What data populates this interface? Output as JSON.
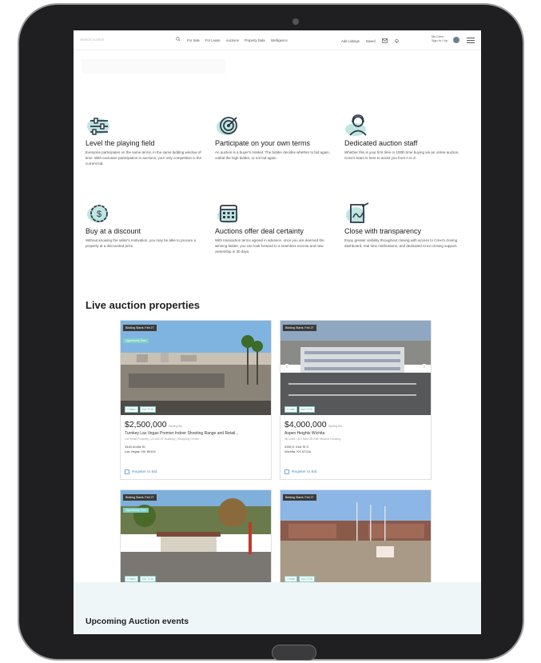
{
  "nav": {
    "search_placeholder": "Search Auction",
    "links": [
      "For Sale",
      "For Lease",
      "Auctions",
      "Property Data",
      "Intelligence"
    ],
    "add_listings": "Add Listings",
    "saved": "Saved",
    "signin_line1": "My Crexi",
    "signin_line2": "Sign In / Up"
  },
  "features": [
    {
      "title": "Level the playing field",
      "text": "Everyone participates on the same terms, in the same bidding window of time. With exclusive participation in auctions, your only competition is the current bid.",
      "icon": "sliders-icon"
    },
    {
      "title": "Participate on your own terms",
      "text": "An auction is a buyer's market. The bidder decides whether to bid again, outbid the high bidder, or not bid again.",
      "icon": "target-icon"
    },
    {
      "title": "Dedicated auction staff",
      "text": "Whether this is your first time or 100th time buying via an online auction, Crexi's team is here to assist you from A to Z.",
      "icon": "support-agent-icon"
    },
    {
      "title": "Buy at a discount",
      "text": "Without knowing the seller's motivation, you may be able to procure a property at a discounted price.",
      "icon": "dollar-circle-icon"
    },
    {
      "title": "Auctions offer deal certainty",
      "text": "With transaction terms agreed in advance, once you are deemed the winning bidder, you can look forward to a seamless escrow and new ownership in 30 days.",
      "icon": "calendar-icon"
    },
    {
      "title": "Close with transparency",
      "text": "Enjoy greater visibility throughout closing with access to Crexi's closing dashboard, real time notifications, and dedicated Crexi closing support.",
      "icon": "signed-document-icon"
    }
  ],
  "live_title": "Live auction properties",
  "upcoming_title": "Upcoming Auction events",
  "cards": [
    {
      "badge": "Bidding Starts: Feb 27",
      "tag": "Opportunity Zone",
      "chips": [
        "3 Sales",
        "AUCTION"
      ],
      "price": "$2,500,000",
      "price_note": "Starting Bid",
      "name": "Turnkey Las Vegas Premier Indoor Shooting Range and Retail...",
      "sub": "Lot Retail Property  |  22,000 SF Building  |  Shopping Center",
      "addr1": "3440 Arville St",
      "addr2": "Las Vegas, NV 89102",
      "register": "Register to Bid"
    },
    {
      "badge": "Bidding Starts: Feb 27",
      "tag": "",
      "chips": [
        "3 Units",
        "AUCTION"
      ],
      "price": "$4,000,000",
      "price_note": "Starting Bid",
      "name": "Aspen Heights Wichita",
      "sub": "96 Units  |  327 Bed Off-Site Student Housing",
      "addr1": "4350 E 31st St S",
      "addr2": "Wichita, KS 67218",
      "register": "Register to Bid"
    },
    {
      "badge": "Bidding Starts: Feb 27",
      "tag": "Opportunity Zone",
      "chips": [
        "3 Sales",
        "AUCTION"
      ],
      "price": "",
      "price_note": "",
      "name": "",
      "sub": "",
      "addr1": "",
      "addr2": "",
      "register": ""
    },
    {
      "badge": "Bidding Starts: Feb 27",
      "tag": "",
      "chips": [
        "3 Units",
        "AUCTION"
      ],
      "price": "",
      "price_note": "",
      "name": "",
      "sub": "",
      "addr1": "",
      "addr2": "",
      "register": ""
    }
  ],
  "colors": {
    "accent": "#7fcfc6",
    "link": "#4a90c8",
    "device": "#1f1f21"
  }
}
